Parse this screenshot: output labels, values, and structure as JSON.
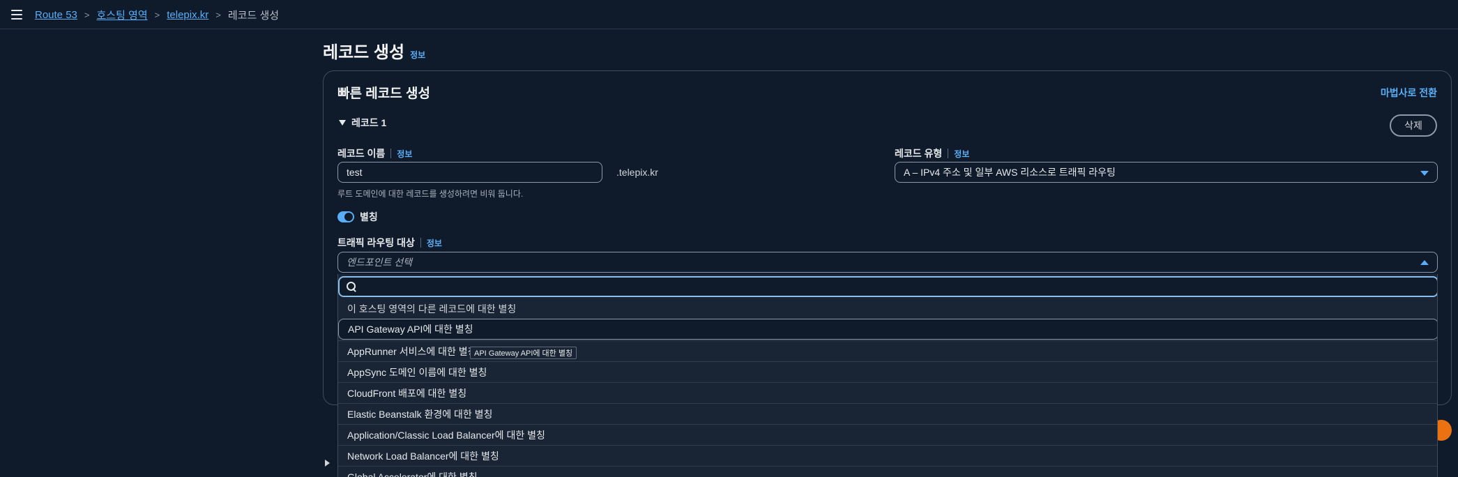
{
  "breadcrumb": {
    "items": [
      "Route 53",
      "호스팅 영역",
      "telepix.kr"
    ],
    "current": "레코드 생성",
    "separator": ">"
  },
  "page": {
    "title": "레코드 생성",
    "info": "정보"
  },
  "panel": {
    "title": "빠른 레코드 생성",
    "wizard_link": "마법사로 전환",
    "record_section": "레코드 1",
    "delete_button": "삭제"
  },
  "record_name": {
    "label": "레코드 이름",
    "info": "정보",
    "value": "test",
    "suffix": ".telepix.kr",
    "hint": "루트 도메인에 대한 레코드를 생성하려면 비워 둡니다."
  },
  "record_type": {
    "label": "레코드 유형",
    "info": "정보",
    "value": "A – IPv4 주소 및 일부 AWS 리소스로 트래픽 라우팅"
  },
  "alias": {
    "label": "별칭",
    "enabled": true
  },
  "traffic_target": {
    "label": "트래픽 라우팅 대상",
    "info": "정보",
    "placeholder": "엔드포인트 선택"
  },
  "dropdown": {
    "search_value": "",
    "options": [
      "이 호스팅 영역의 다른 레코드에 대한 별칭",
      "API Gateway API에 대한 별칭",
      "AppRunner 서비스에 대한 별칭",
      "AppSync 도메인 이름에 대한 별칭",
      "CloudFront 배포에 대한 별칭",
      "Elastic Beanstalk 환경에 대한 별칭",
      "Application/Classic Load Balancer에 대한 별칭",
      "Network Load Balancer에 대한 별칭",
      "Global Accelerator에 대한 별칭"
    ],
    "hovered_index": 1,
    "tooltip": "API Gateway API에 대한 별칭"
  },
  "colors": {
    "background": "#0f1b2a",
    "link": "#5aaef8",
    "border": "#414d5c",
    "accent_orange": "#ec7211"
  }
}
